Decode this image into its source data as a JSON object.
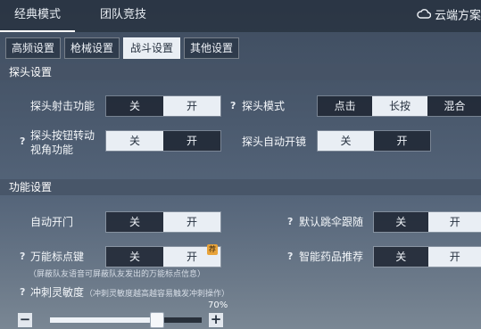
{
  "top_tabs": [
    {
      "label": "经典模式",
      "active": true
    },
    {
      "label": "团队竞技",
      "active": false
    }
  ],
  "cloud_plan": {
    "label": "云端方案",
    "icon": "cloud-icon"
  },
  "sub_tabs": [
    {
      "label": "高频设置",
      "active": false
    },
    {
      "label": "枪械设置",
      "active": false
    },
    {
      "label": "战斗设置",
      "active": true
    },
    {
      "label": "其他设置",
      "active": false
    }
  ],
  "peek_section": {
    "title": "探头设置",
    "peek_fire": {
      "label": "探头射击功能",
      "options": [
        "关",
        "开"
      ],
      "selected": "开"
    },
    "peek_mode": {
      "help": "?",
      "label": "探头模式",
      "options": [
        "点击",
        "长按",
        "混合"
      ],
      "selected": "长按"
    },
    "peek_rotate": {
      "help": "?",
      "label_line1": "探头按钮转动",
      "label_line2": "视角功能",
      "options": [
        "关",
        "开"
      ],
      "selected": "关"
    },
    "peek_auto_scope": {
      "label": "探头自动开镜",
      "options": [
        "关",
        "开"
      ],
      "selected": "关"
    }
  },
  "func_section": {
    "title": "功能设置",
    "auto_door": {
      "label": "自动开门",
      "options": [
        "关",
        "开"
      ],
      "selected": "开"
    },
    "default_follow": {
      "help": "?",
      "label": "默认跳伞跟随",
      "options": [
        "关",
        "开"
      ],
      "selected": "开"
    },
    "universal_mark": {
      "help": "?",
      "label": "万能标点键",
      "options": [
        "关",
        "开"
      ],
      "selected": "开",
      "badge": "荐",
      "note": "（屏蔽队友语音可屏蔽队友发出的万能标点信息）"
    },
    "smart_med": {
      "help": "?",
      "label": "智能药品推荐",
      "options": [
        "关",
        "开"
      ],
      "selected": "开"
    },
    "sprint_sensitivity": {
      "help": "?",
      "label": "冲刺灵敏度",
      "note": "（冲刺灵敏度越高越容易触发冲刺操作）",
      "value_label": "70%",
      "value": 0.7,
      "minus": "−",
      "plus": "+"
    }
  }
}
